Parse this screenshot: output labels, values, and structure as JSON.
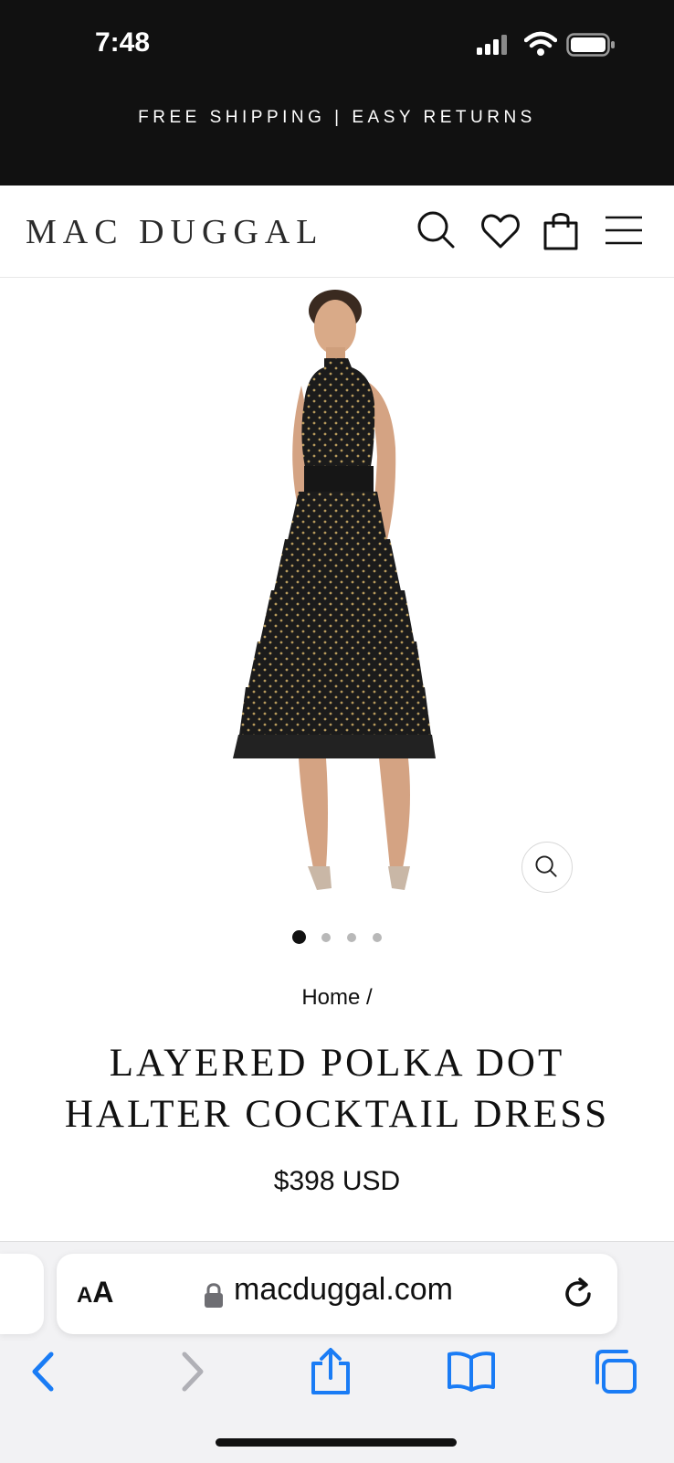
{
  "status_bar": {
    "time": "7:48"
  },
  "promo": {
    "text": "FREE SHIPPING | EASY RETURNS"
  },
  "header": {
    "logo": "MAC DUGGAL"
  },
  "gallery": {
    "image_count": 4,
    "active_index": 0
  },
  "product": {
    "breadcrumb": "Home /",
    "title_line1": "LAYERED POLKA DOT",
    "title_line2": "HALTER COCKTAIL DRESS",
    "price": "$398 USD"
  },
  "browser": {
    "aa_small": "A",
    "aa_large": "A",
    "url": "macduggal.com"
  },
  "colors": {
    "topbar": "#111111",
    "ios_blue": "#1a7cf5",
    "disabled": "#b0b0b6"
  }
}
